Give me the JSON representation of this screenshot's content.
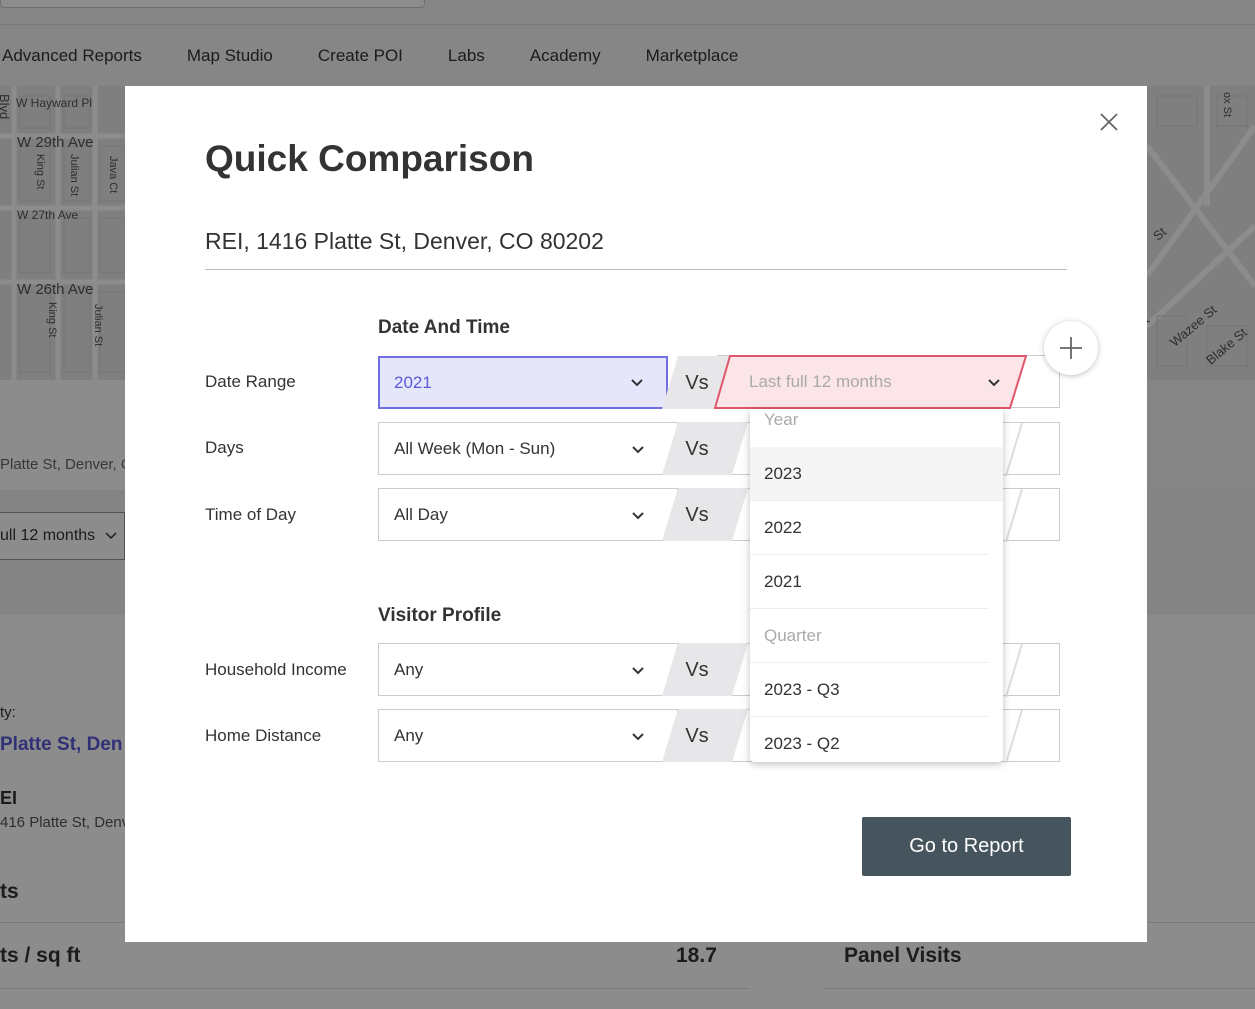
{
  "nav": {
    "items": [
      "Advanced Reports",
      "Map Studio",
      "Create POI",
      "Labs",
      "Academy",
      "Marketplace"
    ]
  },
  "map": {
    "left_labels": [
      "W Hayward Pl",
      "W 29th Ave",
      "King St",
      "Julian St",
      "Java Ct",
      "W 27th Ave",
      "W 26th Ave",
      "King St",
      "Julian St",
      "Blvd"
    ],
    "right_labels": [
      "St",
      "St",
      "Wazee St",
      "Blake St",
      "ox St"
    ]
  },
  "background": {
    "address_fragment": "Platte St, Denver, C",
    "date_fragment": "ull 12 months",
    "prop_label": "ty:",
    "prop_value": "Platte St, Den",
    "poi_name": "EI",
    "poi_address": "416 Platte St, Denve",
    "metric1": "ts",
    "metric2": "ts / sq ft",
    "metric2_value": "18.7",
    "metric3": "Panel Visits"
  },
  "modal": {
    "title": "Quick Comparison",
    "venue": "REI, 1416 Platte St, Denver, CO 80202",
    "sections": {
      "date_time": "Date And Time",
      "visitor_profile": "Visitor Profile"
    },
    "rows": {
      "date_range": {
        "label": "Date Range",
        "value": "2021",
        "compare_placeholder": "Last full 12 months"
      },
      "days": {
        "label": "Days",
        "value": "All Week (Mon - Sun)"
      },
      "time_of_day": {
        "label": "Time of Day",
        "value": "All Day"
      },
      "household_income": {
        "label": "Household Income",
        "value": "Any"
      },
      "home_distance": {
        "label": "Home Distance",
        "value": "Any"
      }
    },
    "vs_label": "Vs",
    "dropdown": {
      "year_header": "Year",
      "year_options": [
        "2023",
        "2022",
        "2021"
      ],
      "quarter_header": "Quarter",
      "quarter_options": [
        "2023 - Q3",
        "2023 - Q2"
      ]
    },
    "go_button": "Go to Report"
  },
  "colors": {
    "active_base": "#6f6fe0",
    "active_base_bg": "#e6e6fa",
    "active_compare": "#e0566a",
    "active_compare_bg": "#fce5e8",
    "primary_button": "#46545d"
  },
  "icons": {
    "close": "close-icon",
    "plus": "plus-icon",
    "chevron": "chevron-down-icon"
  }
}
